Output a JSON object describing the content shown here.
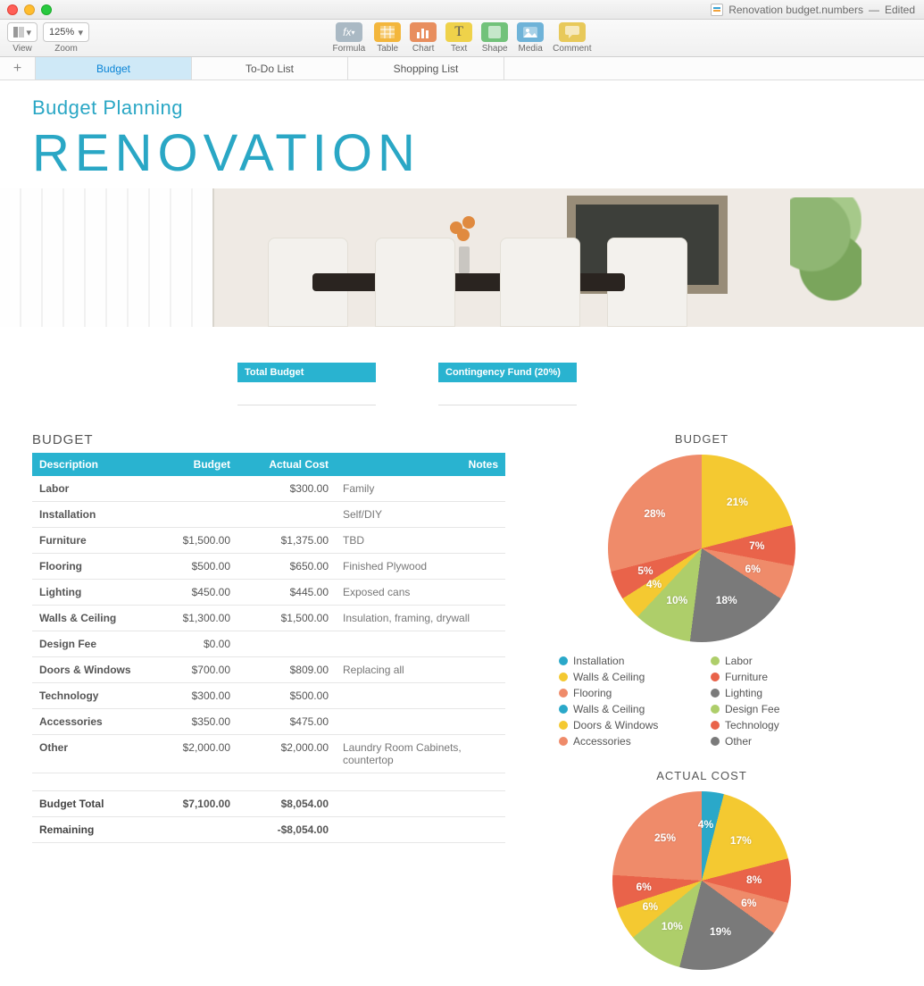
{
  "window": {
    "filename": "Renovation budget.numbers",
    "status": "Edited"
  },
  "toolbar": {
    "view": "View",
    "zoom_label": "Zoom",
    "zoom_value": "125%",
    "formula": "Formula",
    "table": "Table",
    "chart": "Chart",
    "text": "Text",
    "shape": "Shape",
    "media": "Media",
    "comment": "Comment"
  },
  "tabs": [
    "Budget",
    "To-Do List",
    "Shopping List"
  ],
  "active_tab": 0,
  "header": {
    "subtitle": "Budget Planning",
    "title": "RENOVATION"
  },
  "summary_cards": {
    "total_budget_label": "Total Budget",
    "contingency_label": "Contingency Fund (20%)"
  },
  "budget_table": {
    "title": "BUDGET",
    "columns": [
      "Description",
      "Budget",
      "Actual Cost",
      "Notes"
    ],
    "rows": [
      {
        "desc": "Labor",
        "budget": "",
        "actual": "$300.00",
        "notes": "Family"
      },
      {
        "desc": "Installation",
        "budget": "",
        "actual": "",
        "notes": "Self/DIY"
      },
      {
        "desc": "Furniture",
        "budget": "$1,500.00",
        "actual": "$1,375.00",
        "notes": "TBD"
      },
      {
        "desc": "Flooring",
        "budget": "$500.00",
        "actual": "$650.00",
        "notes": "Finished Plywood"
      },
      {
        "desc": "Lighting",
        "budget": "$450.00",
        "actual": "$445.00",
        "notes": "Exposed cans"
      },
      {
        "desc": "Walls & Ceiling",
        "budget": "$1,300.00",
        "actual": "$1,500.00",
        "notes": "Insulation, framing, drywall"
      },
      {
        "desc": "Design Fee",
        "budget": "$0.00",
        "actual": "",
        "notes": ""
      },
      {
        "desc": "Doors & Windows",
        "budget": "$700.00",
        "actual": "$809.00",
        "notes": "Replacing all"
      },
      {
        "desc": "Technology",
        "budget": "$300.00",
        "actual": "$500.00",
        "notes": ""
      },
      {
        "desc": "Accessories",
        "budget": "$350.00",
        "actual": "$475.00",
        "notes": ""
      },
      {
        "desc": "Other",
        "budget": "$2,000.00",
        "actual": "$2,000.00",
        "notes": "Laundry Room Cabinets, countertop"
      }
    ],
    "totals": {
      "budget_total_label": "Budget Total",
      "budget_total_budget": "$7,100.00",
      "budget_total_actual": "$8,054.00",
      "remaining_label": "Remaining",
      "remaining_value": "-$8,054.00"
    }
  },
  "legend": [
    {
      "label": "Installation",
      "color": "#2aa8c9"
    },
    {
      "label": "Labor",
      "color": "#aece6a"
    },
    {
      "label": "Walls & Ceiling",
      "color": "#f4c931"
    },
    {
      "label": "Furniture",
      "color": "#e9634a"
    },
    {
      "label": "Flooring",
      "color": "#ef8b6a"
    },
    {
      "label": "Lighting",
      "color": "#7a7a7a"
    },
    {
      "label": "Walls & Ceiling",
      "color": "#2aa8c9"
    },
    {
      "label": "Design Fee",
      "color": "#aece6a"
    },
    {
      "label": "Doors & Windows",
      "color": "#f4c931"
    },
    {
      "label": "Technology",
      "color": "#e9634a"
    },
    {
      "label": "Accessories",
      "color": "#ef8b6a"
    },
    {
      "label": "Other",
      "color": "#7a7a7a"
    }
  ],
  "chart_data": [
    {
      "type": "pie",
      "title": "BUDGET",
      "series": [
        {
          "name": "Walls & Ceiling",
          "value": 21,
          "color": "#f4c931"
        },
        {
          "name": "Furniture",
          "value": 7,
          "color": "#e9634a"
        },
        {
          "name": "Flooring",
          "value": 6,
          "color": "#ef8b6a"
        },
        {
          "name": "Lighting",
          "value": 18,
          "color": "#7a7a7a"
        },
        {
          "name": "Doors & Windows",
          "value": 10,
          "color": "#aece6a"
        },
        {
          "name": "Technology",
          "value": 4,
          "color": "#f4c931"
        },
        {
          "name": "Accessories",
          "value": 5,
          "color": "#e9634a"
        },
        {
          "name": "Other",
          "value": 28,
          "color": "#ef8b6a"
        }
      ],
      "labels": [
        "21%",
        "7%",
        "6%",
        "18%",
        "10%",
        "4%",
        "5%",
        "28%"
      ]
    },
    {
      "type": "pie",
      "title": "ACTUAL COST",
      "series": [
        {
          "name": "Labor",
          "value": 4,
          "color": "#2aa8c9"
        },
        {
          "name": "Walls & Ceiling",
          "value": 17,
          "color": "#f4c931"
        },
        {
          "name": "Furniture",
          "value": 8,
          "color": "#e9634a"
        },
        {
          "name": "Flooring",
          "value": 6,
          "color": "#ef8b6a"
        },
        {
          "name": "Lighting",
          "value": 19,
          "color": "#7a7a7a"
        },
        {
          "name": "Doors & Windows",
          "value": 10,
          "color": "#aece6a"
        },
        {
          "name": "Technology",
          "value": 6,
          "color": "#f4c931"
        },
        {
          "name": "Accessories",
          "value": 6,
          "color": "#e9634a"
        },
        {
          "name": "Other",
          "value": 25,
          "color": "#ef8b6a"
        }
      ],
      "labels": [
        "4%",
        "17%",
        "8%",
        "6%",
        "19%",
        "10%",
        "6%",
        "6%",
        "25%"
      ]
    }
  ]
}
